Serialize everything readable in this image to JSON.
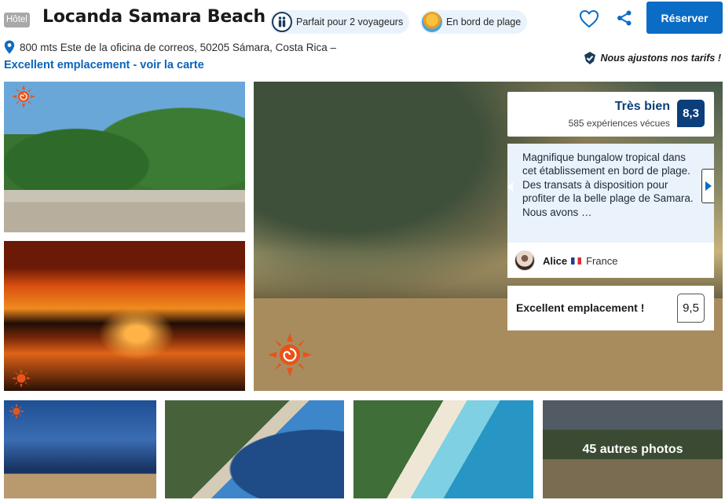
{
  "header": {
    "type_badge": "Hôtel",
    "title": "Locanda Samara Beach",
    "chips": [
      {
        "label": "Parfait pour 2 voyageurs",
        "icon": "couple-icon"
      },
      {
        "label": "En bord de plage",
        "icon": "beach-sunset-icon"
      }
    ],
    "favorite_icon": "heart-icon",
    "share_icon": "share-icon",
    "reserve_label": "Réserver"
  },
  "location": {
    "address": "800 mts Este de la oficina de correos, 50205 Sámara, Costa Rica –",
    "map_link": "Excellent emplacement - voir la carte",
    "price_match": "Nous ajustons nos tarifs !"
  },
  "gallery": {
    "more_photos": "45 autres photos"
  },
  "rating": {
    "label": "Très bien",
    "count": "585 expériences vécues",
    "score": "8,3"
  },
  "review": {
    "text": "Magnifique bungalow tropical dans cet établissement en bord de plage. Des transats à disposition pour profiter de la belle plage de Samara. Nous avons …",
    "author": "Alice",
    "country": "France"
  },
  "location_score": {
    "label": "Excellent emplacement !",
    "score": "9,5"
  },
  "colors": {
    "accent_blue": "#0b6cc5",
    "rating_navy": "#0b3e7a",
    "link_blue": "#0b63b8",
    "chip_bg": "#eaf3fc",
    "review_bg": "#eaf2fb",
    "sun_orange": "#e8531a"
  }
}
